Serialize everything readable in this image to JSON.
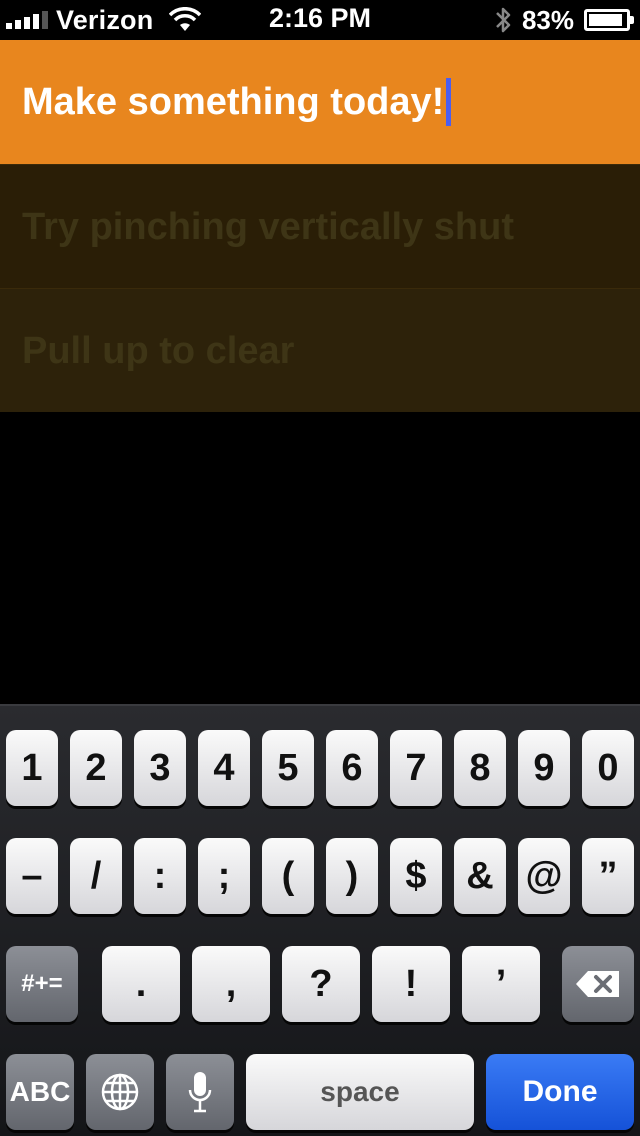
{
  "status_bar": {
    "carrier": "Verizon",
    "time": "2:16 PM",
    "battery_percent": "83%",
    "battery_level": 0.83,
    "icons": [
      "signal-icon",
      "wifi-icon",
      "bluetooth-icon",
      "battery-icon"
    ]
  },
  "list": {
    "editing_item": "Make something today!",
    "items": [
      {
        "text": "Try pinching vertically shut"
      },
      {
        "text": "Pull up to clear"
      }
    ]
  },
  "keyboard": {
    "row1": [
      "1",
      "2",
      "3",
      "4",
      "5",
      "6",
      "7",
      "8",
      "9",
      "0"
    ],
    "row2": [
      "–",
      "/",
      ":",
      ";",
      "(",
      ")",
      "$",
      "&",
      "@",
      "”"
    ],
    "more_symbols_label": "#+=",
    "row3": [
      ".",
      ",",
      "?",
      "!",
      "’"
    ],
    "abc_label": "ABC",
    "space_label": "space",
    "done_label": "Done",
    "icons": [
      "delete-icon",
      "globe-icon",
      "microphone-icon"
    ]
  },
  "colors": {
    "editing_row": "#e8861e",
    "dim_row_1": "#2a1e06",
    "dim_row_2": "#2d220a",
    "done_key": "#1f62e6",
    "cursor": "#4b5ef0"
  }
}
